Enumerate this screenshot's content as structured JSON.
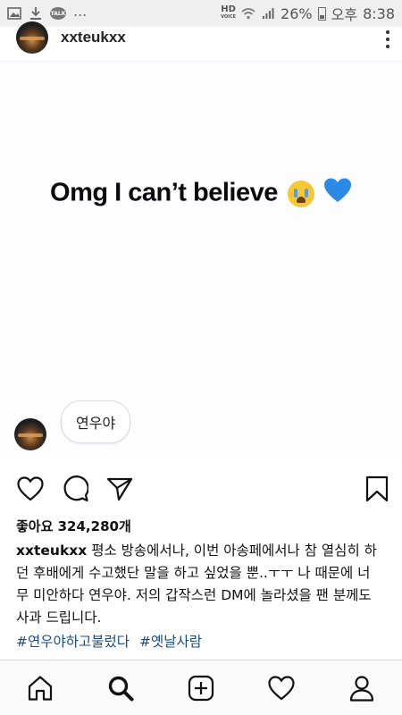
{
  "status_bar": {
    "talk_badge": "TALK",
    "dots": "...",
    "hd_label": "HD",
    "hd_sub": "VOICE",
    "battery": "26%",
    "ampm": "오후",
    "time": "8:38"
  },
  "post": {
    "username": "xxteukxx",
    "image_text": "Omg I can’t believe",
    "image_comment": "연우야"
  },
  "likes": {
    "label": "좋아요 324,280개"
  },
  "caption": {
    "username": "xxteukxx",
    "text": "평소 방송에서나, 이번 아송페에서나 참 열심히 하던 후배에게 수고했단 말을 하고 싶었을 뿐..ㅜㅜ 나 때문에 너무 미안하다 연우야. 저의 갑작스런 DM에 놀라셨을 팬 분께도 사과 드립니다.",
    "hashtags": [
      "#연우야하고불렀다",
      "#옛날사람"
    ]
  },
  "colors": {
    "hashtag": "#1b4a8a",
    "statusbar_bg": "#efefef"
  },
  "icons": {
    "actions": [
      "heart-icon",
      "comment-icon",
      "share-icon",
      "bookmark-icon"
    ],
    "nav": [
      "home-icon",
      "search-icon",
      "add-post-icon",
      "activity-heart-icon",
      "profile-icon"
    ]
  }
}
